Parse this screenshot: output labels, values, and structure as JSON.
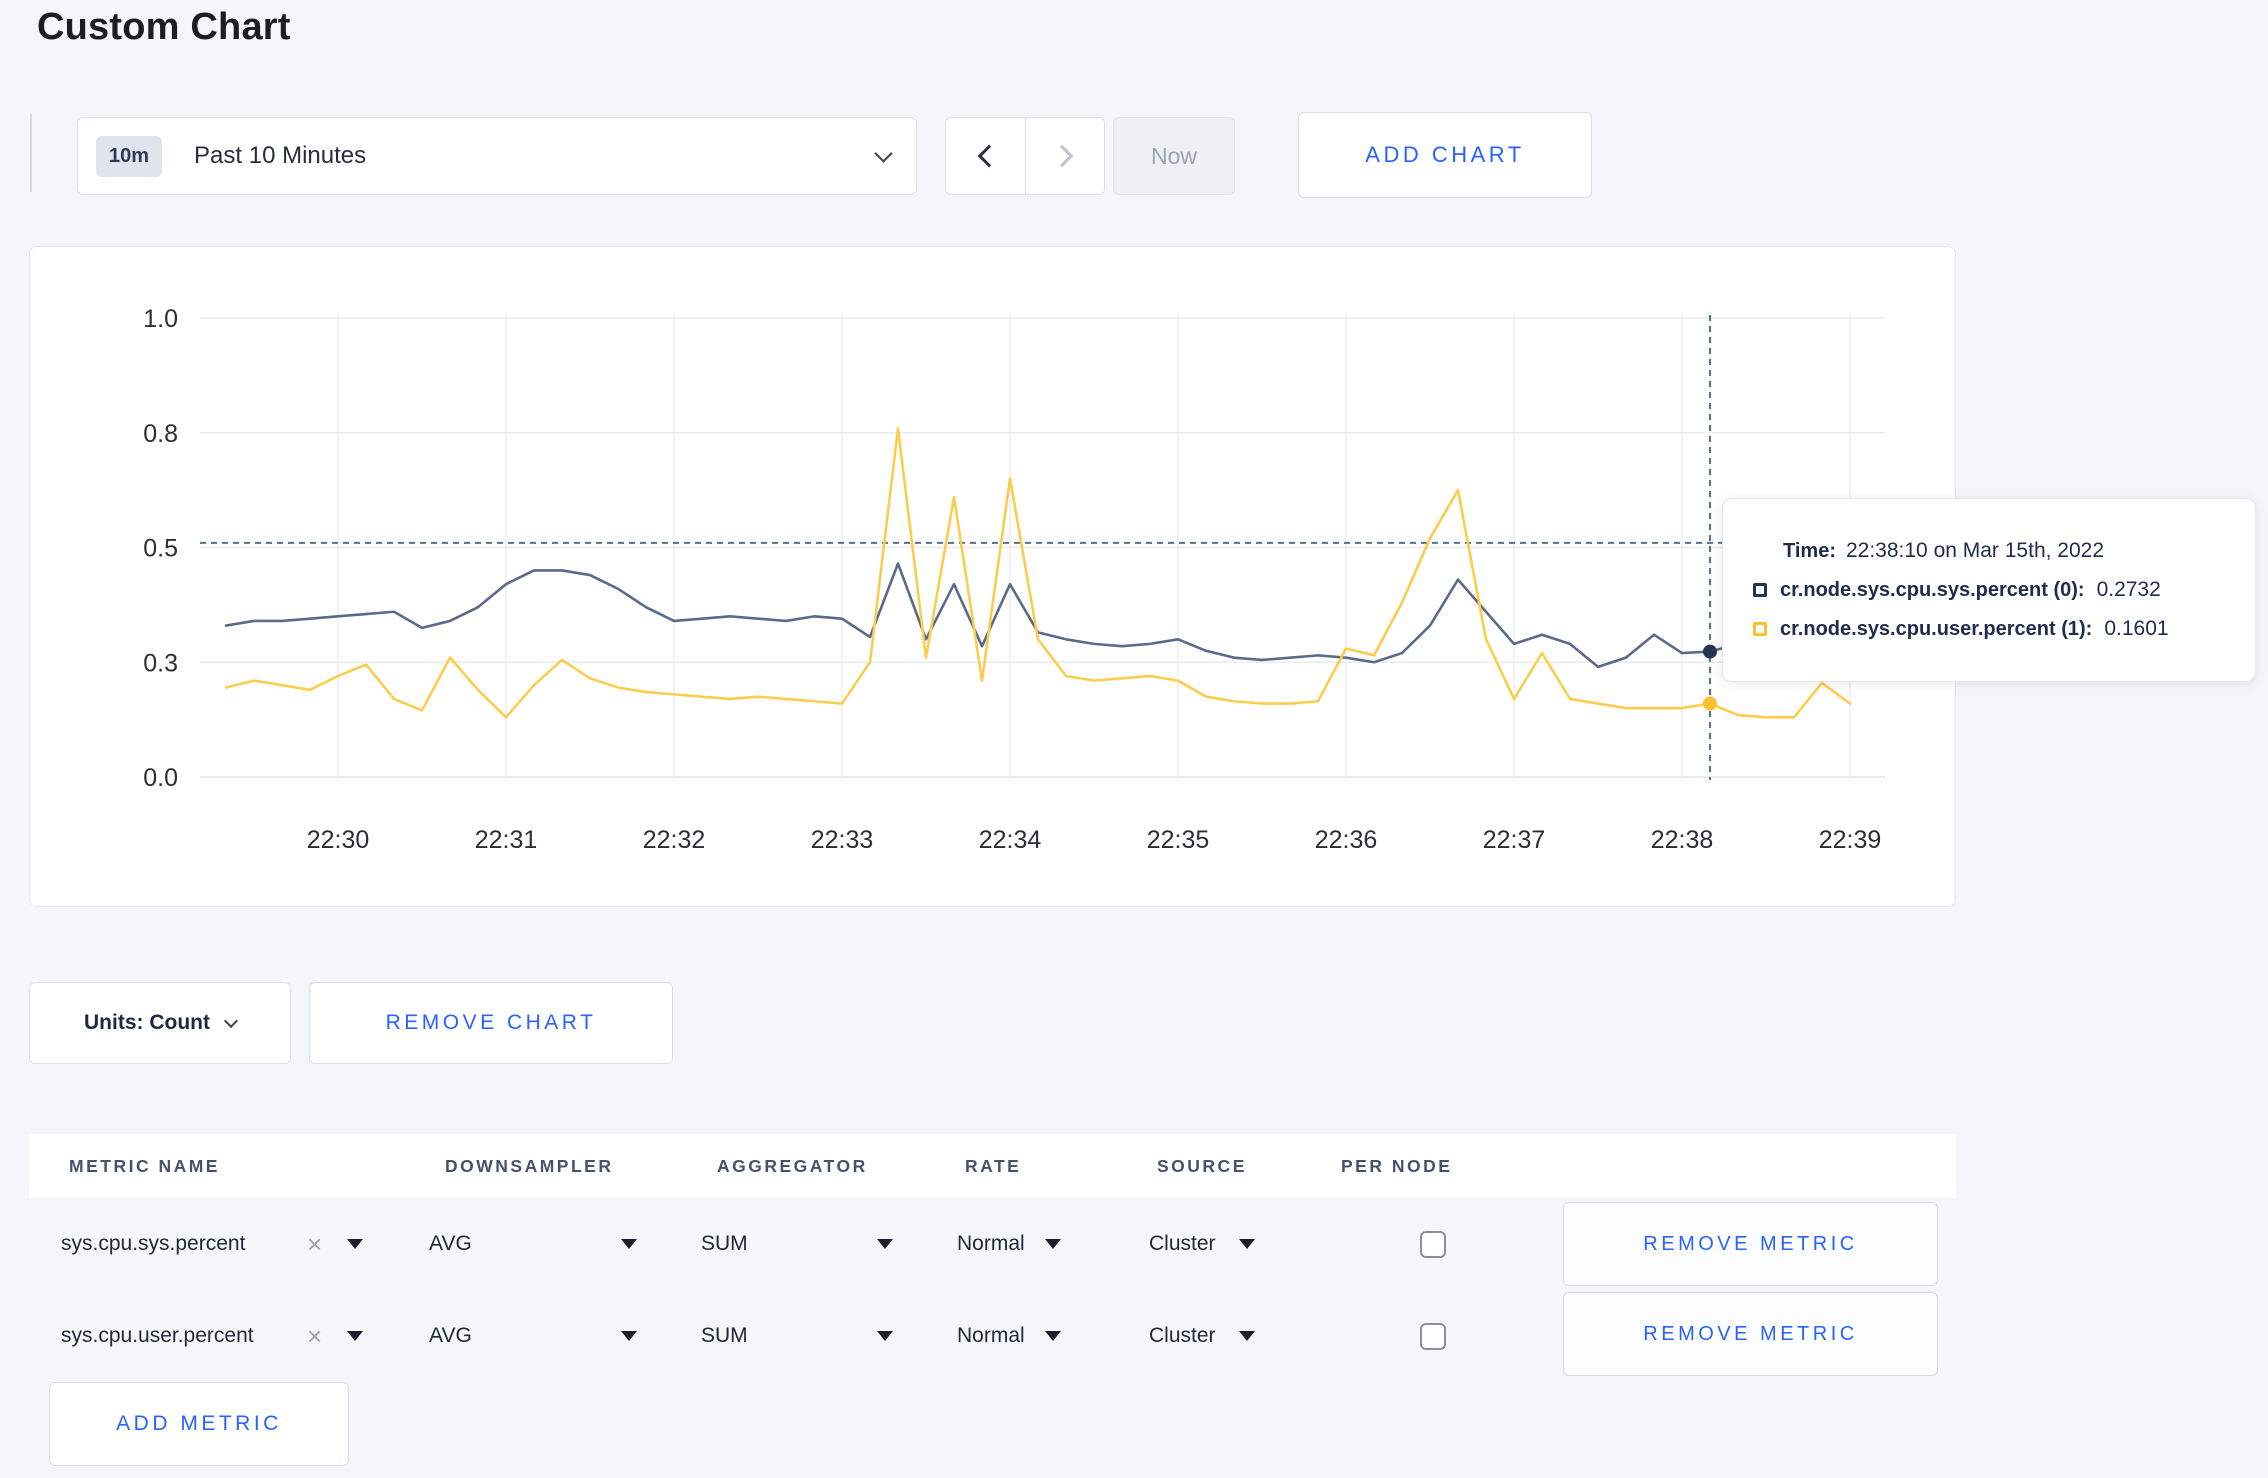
{
  "page": {
    "title": "Custom Chart",
    "background": "#f5f6fa",
    "accent_blue": "#2962ff"
  },
  "toolbar": {
    "time_range": {
      "badge": "10m",
      "label": "Past 10 Minutes"
    },
    "now_label": "Now",
    "add_chart_label": "ADD CHART"
  },
  "icons": {
    "time_dropdown_chevron": "chevron-down",
    "prev": "chevron-left",
    "next": "chevron-right",
    "units_chevron": "chevron-down",
    "metric_remove_glyph": "×",
    "select_arrow": "triangle-down",
    "checkbox_state": "unchecked"
  },
  "chart_data": {
    "type": "line",
    "title": "",
    "xlabel": "",
    "ylabel": "",
    "ylim": [
      0,
      1
    ],
    "grid": true,
    "x_ticks": [
      "22:30",
      "22:31",
      "22:32",
      "22:33",
      "22:34",
      "22:35",
      "22:36",
      "22:37",
      "22:38",
      "22:39"
    ],
    "y_ticks": [
      {
        "label": "1.0",
        "value": 1.0
      },
      {
        "label": "0.8",
        "value": 0.75
      },
      {
        "label": "0.5",
        "value": 0.5
      },
      {
        "label": "0.3",
        "value": 0.25
      },
      {
        "label": "0.0",
        "value": 0.0
      }
    ],
    "x_start_time": "22:29:20",
    "x_interval_seconds": 10,
    "series": [
      {
        "name": "cr.node.sys.cpu.sys.percent",
        "color": "#5b6a89",
        "values": [
          0.33,
          0.34,
          0.34,
          0.345,
          0.35,
          0.355,
          0.36,
          0.325,
          0.34,
          0.37,
          0.42,
          0.45,
          0.45,
          0.44,
          0.41,
          0.37,
          0.34,
          0.345,
          0.35,
          0.345,
          0.34,
          0.35,
          0.345,
          0.305,
          0.465,
          0.3,
          0.42,
          0.285,
          0.42,
          0.315,
          0.3,
          0.29,
          0.285,
          0.29,
          0.3,
          0.275,
          0.26,
          0.255,
          0.26,
          0.265,
          0.26,
          0.25,
          0.27,
          0.33,
          0.43,
          0.36,
          0.29,
          0.31,
          0.29,
          0.24,
          0.26,
          0.31,
          0.27,
          0.2732,
          0.29,
          0.3,
          0.3,
          0.295,
          0.3
        ]
      },
      {
        "name": "cr.node.sys.cpu.user.percent",
        "color": "#fccd4d",
        "values": [
          0.195,
          0.21,
          0.2,
          0.19,
          0.22,
          0.245,
          0.17,
          0.145,
          0.26,
          0.19,
          0.13,
          0.2,
          0.255,
          0.215,
          0.195,
          0.185,
          0.18,
          0.175,
          0.17,
          0.175,
          0.17,
          0.165,
          0.16,
          0.25,
          0.76,
          0.26,
          0.61,
          0.21,
          0.65,
          0.3,
          0.22,
          0.21,
          0.215,
          0.22,
          0.21,
          0.175,
          0.165,
          0.16,
          0.16,
          0.165,
          0.28,
          0.265,
          0.38,
          0.52,
          0.625,
          0.3,
          0.17,
          0.27,
          0.17,
          0.16,
          0.15,
          0.15,
          0.15,
          0.1601,
          0.135,
          0.13,
          0.13,
          0.205,
          0.16
        ]
      }
    ],
    "legend_position": "tooltip-only"
  },
  "hover": {
    "time_label": "Time:",
    "time_value": "22:38:10 on Mar 15th, 2022",
    "point_index": 53,
    "crosshair_y_value": 0.51,
    "rows": [
      {
        "swatch_color": "#26324e",
        "label": "cr.node.sys.cpu.sys.percent (0):",
        "value": "0.2732"
      },
      {
        "swatch_color": "#fdc12e",
        "label": "cr.node.sys.cpu.user.percent (1):",
        "value": "0.1601"
      }
    ]
  },
  "chart_controls": {
    "units_label": "Units: Count",
    "remove_chart_label": "REMOVE CHART",
    "add_metric_label": "ADD METRIC"
  },
  "metrics_table": {
    "headers": [
      "METRIC NAME",
      "DOWNSAMPLER",
      "AGGREGATOR",
      "RATE",
      "SOURCE",
      "PER NODE"
    ],
    "rows": [
      {
        "metric_name": "sys.cpu.sys.percent",
        "downsampler": "AVG",
        "aggregator": "SUM",
        "rate": "Normal",
        "source": "Cluster",
        "per_node_checked": false,
        "remove_label": "REMOVE METRIC"
      },
      {
        "metric_name": "sys.cpu.user.percent",
        "downsampler": "AVG",
        "aggregator": "SUM",
        "rate": "Normal",
        "source": "Cluster",
        "per_node_checked": false,
        "remove_label": "REMOVE METRIC"
      }
    ]
  }
}
